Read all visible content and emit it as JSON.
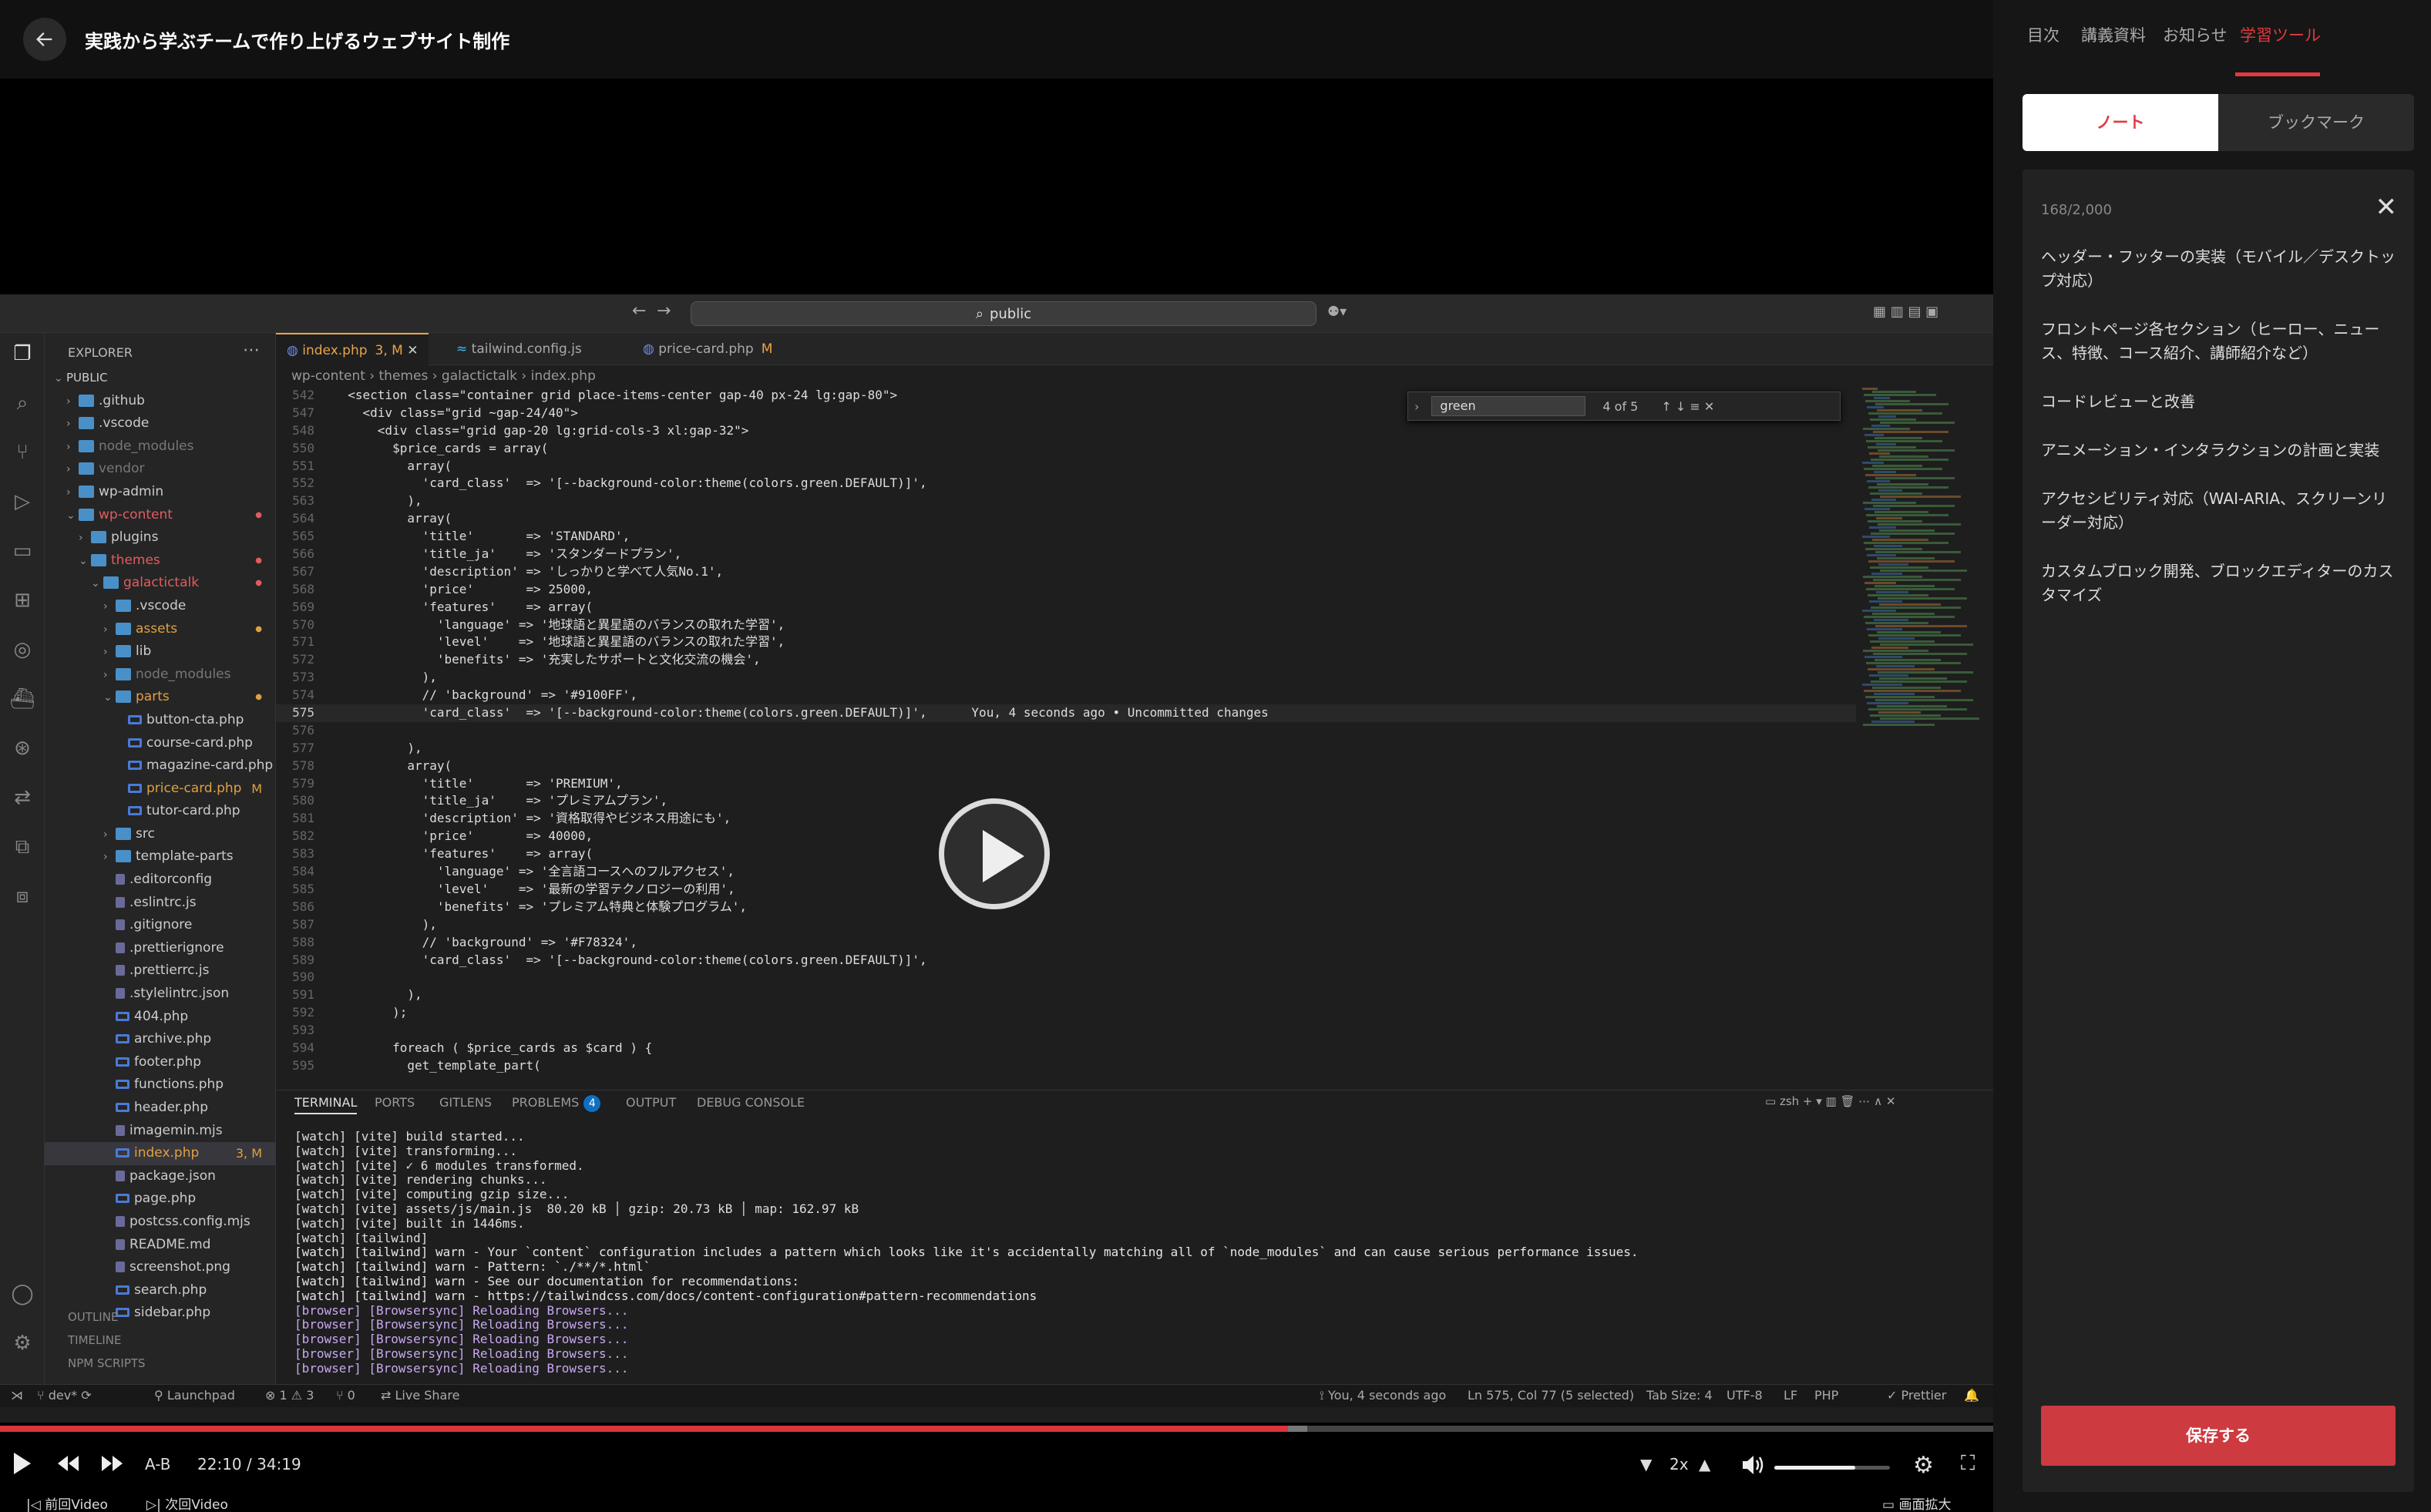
{
  "header": {
    "back_icon": "arrow-left-icon",
    "title": "実践から学ぶチームで作り上げるウェブサイト制作"
  },
  "side_tabs": [
    "目次",
    "講義資料",
    "お知らせ",
    "学習ツール"
  ],
  "side_active_tab": "学習ツール",
  "segments": {
    "note": "ノート",
    "bookmark": "ブックマーク"
  },
  "note": {
    "counter": "168/2,000",
    "paragraphs": [
      "ヘッダー・フッターの実装（モバイル／デスクトップ対応）",
      "フロントページ各セクション（ヒーロー、ニュース、特徴、コース紹介、講師紹介など）",
      "コードレビューと改善",
      "アニメーション・インタラクションの計画と実装",
      "アクセシビリティ対応（WAI-ARIA、スクリーンリーダー対応）",
      "カスタムブロック開発、ブロックエディターのカスタマイズ"
    ],
    "save_label": "保存する"
  },
  "player": {
    "current_time": "22:10",
    "separator": "/",
    "duration": "34:19",
    "progress": 0.646,
    "buffered": 0.541,
    "ab_label": "A-B",
    "speed": "2x",
    "volume": 0.7,
    "prev_label": "前回Video",
    "next_label": "次回Video",
    "zoom_label": "画面拡大",
    "accent": "#d9353b"
  },
  "vscode": {
    "search": "public",
    "explorer_title": "EXPLORER",
    "tree": [
      {
        "name": "PUBLIC",
        "depth": 0,
        "type": "root"
      },
      {
        "name": ".github",
        "depth": 1,
        "type": "folder"
      },
      {
        "name": ".vscode",
        "depth": 1,
        "type": "folder"
      },
      {
        "name": "node_modules",
        "depth": 1,
        "type": "folder",
        "dim": true
      },
      {
        "name": "vendor",
        "depth": 1,
        "type": "folder",
        "dim": true
      },
      {
        "name": "wp-admin",
        "depth": 1,
        "type": "folder"
      },
      {
        "name": "wp-content",
        "depth": 1,
        "type": "folder",
        "open": true,
        "color": "red",
        "dot": true
      },
      {
        "name": "plugins",
        "depth": 2,
        "type": "folder"
      },
      {
        "name": "themes",
        "depth": 2,
        "type": "folder",
        "open": true,
        "color": "red",
        "dot": true
      },
      {
        "name": "galactictalk",
        "depth": 3,
        "type": "folder",
        "open": true,
        "color": "red",
        "dot": true
      },
      {
        "name": ".vscode",
        "depth": 4,
        "type": "folder"
      },
      {
        "name": "assets",
        "depth": 4,
        "type": "folder",
        "color": "orange",
        "dot": true
      },
      {
        "name": "lib",
        "depth": 4,
        "type": "folder"
      },
      {
        "name": "node_modules",
        "depth": 4,
        "type": "folder",
        "dim": true
      },
      {
        "name": "parts",
        "depth": 4,
        "type": "folder",
        "open": true,
        "color": "orange",
        "dot": true
      },
      {
        "name": "button-cta.php",
        "depth": 5,
        "type": "php"
      },
      {
        "name": "course-card.php",
        "depth": 5,
        "type": "php"
      },
      {
        "name": "magazine-card.php",
        "depth": 5,
        "type": "php"
      },
      {
        "name": "price-card.php",
        "depth": 5,
        "type": "php",
        "color": "orange",
        "status": "M"
      },
      {
        "name": "tutor-card.php",
        "depth": 5,
        "type": "php"
      },
      {
        "name": "src",
        "depth": 4,
        "type": "folder"
      },
      {
        "name": "template-parts",
        "depth": 4,
        "type": "folder"
      },
      {
        "name": ".editorconfig",
        "depth": 4,
        "type": "file"
      },
      {
        "name": ".eslintrc.js",
        "depth": 4,
        "type": "file"
      },
      {
        "name": ".gitignore",
        "depth": 4,
        "type": "file"
      },
      {
        "name": ".prettierignore",
        "depth": 4,
        "type": "file"
      },
      {
        "name": ".prettierrc.js",
        "depth": 4,
        "type": "file"
      },
      {
        "name": ".stylelintrc.json",
        "depth": 4,
        "type": "file"
      },
      {
        "name": "404.php",
        "depth": 4,
        "type": "php"
      },
      {
        "name": "archive.php",
        "depth": 4,
        "type": "php"
      },
      {
        "name": "footer.php",
        "depth": 4,
        "type": "php"
      },
      {
        "name": "functions.php",
        "depth": 4,
        "type": "php"
      },
      {
        "name": "header.php",
        "depth": 4,
        "type": "php"
      },
      {
        "name": "imagemin.mjs",
        "depth": 4,
        "type": "file"
      },
      {
        "name": "index.php",
        "depth": 4,
        "type": "php",
        "color": "orange",
        "status": "3, M",
        "selected": true
      },
      {
        "name": "package.json",
        "depth": 4,
        "type": "file"
      },
      {
        "name": "page.php",
        "depth": 4,
        "type": "php"
      },
      {
        "name": "postcss.config.mjs",
        "depth": 4,
        "type": "file"
      },
      {
        "name": "README.md",
        "depth": 4,
        "type": "file"
      },
      {
        "name": "screenshot.png",
        "depth": 4,
        "type": "file"
      },
      {
        "name": "search.php",
        "depth": 4,
        "type": "php"
      },
      {
        "name": "sidebar.php",
        "depth": 4,
        "type": "php"
      }
    ],
    "outline_sections": [
      "OUTLINE",
      "TIMELINE",
      "NPM SCRIPTS"
    ],
    "tabs": [
      {
        "name": "index.php",
        "status": "3, M",
        "active": true
      },
      {
        "name": "tailwind.config.js",
        "status": ""
      },
      {
        "name": "price-card.php",
        "status": "M"
      }
    ],
    "breadcrumb": "wp-content › themes › galactictalk › index.php",
    "find": {
      "query": "green",
      "count": "4 of 5"
    },
    "code": [
      {
        "n": "542",
        "t": "  <section class=\"container grid place-items-center gap-40 px-24 lg:gap-80\">"
      },
      {
        "n": "547",
        "t": "    <div class=\"grid ~gap-24/40\">"
      },
      {
        "n": "548",
        "t": "      <div class=\"grid gap-20 lg:grid-cols-3 xl:gap-32\">"
      },
      {
        "n": "550",
        "t": "        $price_cards = array("
      },
      {
        "n": "551",
        "t": "          array("
      },
      {
        "n": "552",
        "t": "            'card_class'  => '[--background-color:theme(colors.green.DEFAULT)]',"
      },
      {
        "n": "563",
        "t": "          ),"
      },
      {
        "n": "564",
        "t": "          array("
      },
      {
        "n": "565",
        "t": "            'title'       => 'STANDARD',"
      },
      {
        "n": "566",
        "t": "            'title_ja'    => 'スタンダードプラン',"
      },
      {
        "n": "567",
        "t": "            'description' => 'しっかりと学べて人気No.1',"
      },
      {
        "n": "568",
        "t": "            'price'       => 25000,"
      },
      {
        "n": "569",
        "t": "            'features'    => array("
      },
      {
        "n": "570",
        "t": "              'language' => '地球語と異星語のバランスの取れた学習',"
      },
      {
        "n": "571",
        "t": "              'level'    => '地球語と異星語のバランスの取れた学習',"
      },
      {
        "n": "572",
        "t": "              'benefits' => '充実したサポートと文化交流の機会',"
      },
      {
        "n": "573",
        "t": "            ),"
      },
      {
        "n": "574",
        "t": "            // 'background' => '#9100FF',"
      },
      {
        "n": "575",
        "t": "            'card_class'  => '[--background-color:theme(colors.green.DEFAULT)]',      You, 4 seconds ago • Uncommitted changes"
      },
      {
        "n": "576",
        "t": ""
      },
      {
        "n": "577",
        "t": "          ),"
      },
      {
        "n": "578",
        "t": "          array("
      },
      {
        "n": "579",
        "t": "            'title'       => 'PREMIUM',"
      },
      {
        "n": "580",
        "t": "            'title_ja'    => 'プレミアムプラン',"
      },
      {
        "n": "581",
        "t": "            'description' => '資格取得やビジネス用途にも',"
      },
      {
        "n": "582",
        "t": "            'price'       => 40000,"
      },
      {
        "n": "583",
        "t": "            'features'    => array("
      },
      {
        "n": "584",
        "t": "              'language' => '全言語コースへのフルアクセス',"
      },
      {
        "n": "585",
        "t": "              'level'    => '最新の学習テクノロジーの利用',"
      },
      {
        "n": "586",
        "t": "              'benefits' => 'プレミアム特典と体験プログラム',"
      },
      {
        "n": "587",
        "t": "            ),"
      },
      {
        "n": "588",
        "t": "            // 'background' => '#F78324',"
      },
      {
        "n": "589",
        "t": "            'card_class'  => '[--background-color:theme(colors.green.DEFAULT)]',"
      },
      {
        "n": "590",
        "t": ""
      },
      {
        "n": "591",
        "t": "          ),"
      },
      {
        "n": "592",
        "t": "        );"
      },
      {
        "n": "593",
        "t": ""
      },
      {
        "n": "594",
        "t": "        foreach ( $price_cards as $card ) {"
      },
      {
        "n": "595",
        "t": "          get_template_part("
      }
    ],
    "current_line": "575",
    "panel_tabs": [
      "TERMINAL",
      "PORTS",
      "GITLENS",
      "PROBLEMS",
      "OUTPUT",
      "DEBUG CONSOLE"
    ],
    "problems_count": "4",
    "terminal_shell": "zsh",
    "terminal": [
      "[watch] [vite] build started...",
      "[watch] [vite] transforming...",
      "[watch] [vite] ✓ 6 modules transformed.",
      "[watch] [vite] rendering chunks...",
      "[watch] [vite] computing gzip size...",
      "[watch] [vite] assets/js/main.js  80.20 kB │ gzip: 20.73 kB │ map: 162.97 kB",
      "[watch] [vite] built in 1446ms.",
      "[watch] [tailwind]",
      "[watch] [tailwind] warn - Your `content` configuration includes a pattern which looks like it's accidentally matching all of `node_modules` and can cause serious performance issues.",
      "[watch] [tailwind] warn - Pattern: `./**/*.html`",
      "[watch] [tailwind] warn - See our documentation for recommendations:",
      "[watch] [tailwind] warn - https://tailwindcss.com/docs/content-configuration#pattern-recommendations",
      "[browser] [Browsersync] Reloading Browsers...",
      "[browser] [Browsersync] Reloading Browsers...",
      "[browser] [Browsersync] Reloading Browsers...",
      "[browser] [Browsersync] Reloading Browsers...",
      "[browser] [Browsersync] Reloading Browsers...",
      ""
    ],
    "status": {
      "branch": "dev*",
      "launchpad": "Launchpad",
      "problems": "⊗ 1 ⚠ 3",
      "ports": "⑂ 0",
      "liveshare": "Live Share",
      "blame": "You, 4 seconds ago",
      "cursor": "Ln 575, Col 77 (5 selected)",
      "tabsize": "Tab Size: 4",
      "encoding": "UTF-8",
      "eol": "LF",
      "lang": "PHP",
      "prettier": "Prettier"
    }
  }
}
